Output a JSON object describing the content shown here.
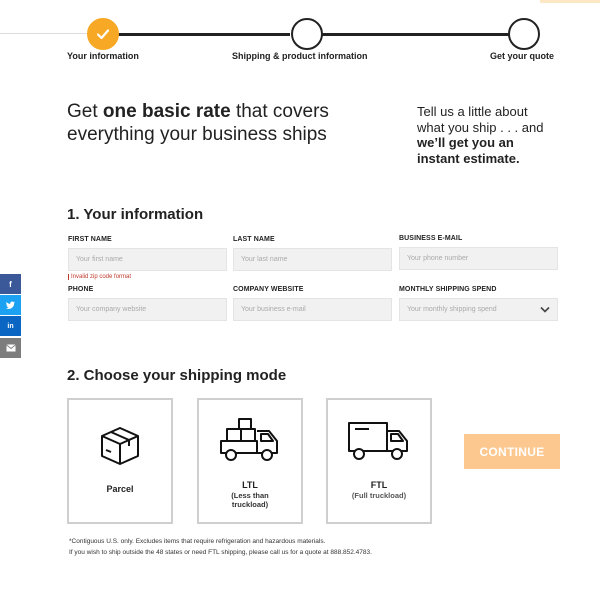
{
  "stepper": {
    "steps": [
      {
        "label": "Your information",
        "state": "complete"
      },
      {
        "label": "Shipping & product information",
        "state": "pending"
      },
      {
        "label": "Get your quote",
        "state": "pending"
      }
    ]
  },
  "hero": {
    "line1_pre": "Get ",
    "line1_bold": "one basic rate",
    "line1_post": " that covers",
    "line2": "everything your business ships",
    "side_line1": "Tell us a little about",
    "side_line2": "what you ship . . . and",
    "side_bold1": "we’ll get you an",
    "side_bold2": "instant estimate."
  },
  "section1": {
    "title": "1. Your information",
    "fields": {
      "first_name": {
        "label": "FIRST NAME",
        "placeholder": "Your first name",
        "error": "Invalid zip code format"
      },
      "last_name": {
        "label": "LAST NAME",
        "placeholder": "Your last name"
      },
      "business_email": {
        "label": "BUSINESS E-MAIL",
        "placeholder": "Your phone number"
      },
      "phone": {
        "label": "PHONE",
        "placeholder": "Your company website"
      },
      "company_website": {
        "label": "COMPANY WEBSITE",
        "placeholder": "Your business e-mail"
      },
      "monthly_spend": {
        "label": "MONTHLY SHIPPING SPEND",
        "placeholder": "Your monthly shipping spend"
      }
    }
  },
  "share": {
    "facebook": "f",
    "twitter": "twitter-icon",
    "linkedin": "in",
    "email": "email-icon"
  },
  "section2": {
    "title": "2. Choose your shipping mode",
    "modes": [
      {
        "name": "Parcel",
        "sub1": "",
        "sub2": ""
      },
      {
        "name": "LTL",
        "sub1": "(Less than",
        "sub2": "truckload)"
      },
      {
        "name": "FTL",
        "sub1": "(Full truckload)",
        "sub2": ""
      }
    ],
    "continue_label": "CONTINUE"
  },
  "footnotes": {
    "line1": "*Contiguous U.S. only. Excludes items that require refrigeration and hazardous materials.",
    "line2": "If you wish to ship outside the 48 states or need FTL shipping, please call us for a quote at 888.852.4783."
  },
  "colors": {
    "accent": "#f7a825",
    "continue_bg": "#fcc88f",
    "error": "#c0392b"
  }
}
